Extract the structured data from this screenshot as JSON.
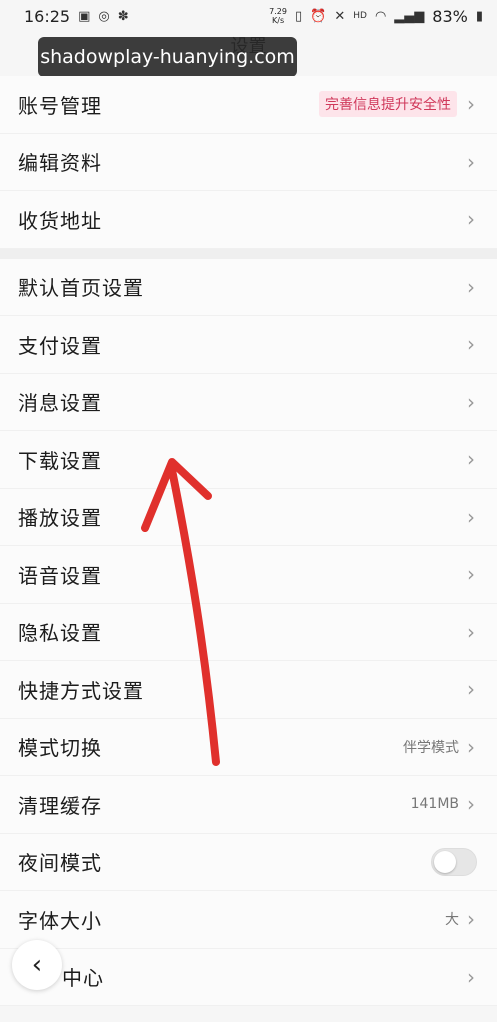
{
  "status_bar": {
    "time": "16:25",
    "speed_value": "7.29",
    "speed_unit": "K/s",
    "hd": "HD",
    "battery": "83%",
    "icons": [
      "image-icon",
      "circle-icon",
      "paw-icon",
      "vibrate-icon",
      "alarm-icon",
      "mute-icon",
      "wifi-icon",
      "signal-icon"
    ]
  },
  "header": {
    "title": "设置"
  },
  "watermark": "shadowplay-huanying.com",
  "groups": [
    {
      "items": [
        {
          "label": "账号管理",
          "badge": "完善信息提升安全性"
        },
        {
          "label": "编辑资料"
        },
        {
          "label": "收货地址"
        }
      ]
    },
    {
      "items": [
        {
          "label": "默认首页设置"
        },
        {
          "label": "支付设置"
        },
        {
          "label": "消息设置"
        },
        {
          "label": "下载设置"
        },
        {
          "label": "播放设置"
        },
        {
          "label": "语音设置"
        },
        {
          "label": "隐私设置"
        },
        {
          "label": "快捷方式设置"
        },
        {
          "label": "模式切换",
          "value": "伴学模式"
        },
        {
          "label": "清理缓存",
          "value": "141MB"
        },
        {
          "label": "夜间模式",
          "toggle": false
        },
        {
          "label": "字体大小",
          "value": "大"
        },
        {
          "label": "中心"
        }
      ]
    }
  ],
  "colors": {
    "badge_text": "#d0395b",
    "badge_bg": "#fde4ea",
    "annotation_arrow": "#e0302c"
  }
}
